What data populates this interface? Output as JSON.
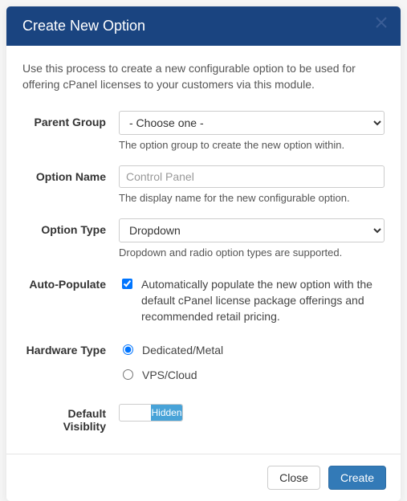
{
  "modal": {
    "title": "Create New Option",
    "intro": "Use this process to create a new configurable option to be used for offering cPanel licenses to your customers via this module."
  },
  "form": {
    "parent_group": {
      "label": "Parent Group",
      "selected": "- Choose one -",
      "help": "The option group to create the new option within."
    },
    "option_name": {
      "label": "Option Name",
      "placeholder": "Control Panel",
      "value": "",
      "help": "The display name for the new configurable option."
    },
    "option_type": {
      "label": "Option Type",
      "selected": "Dropdown",
      "help": "Dropdown and radio option types are supported."
    },
    "auto_populate": {
      "label": "Auto-Populate",
      "checked": true,
      "text": "Automatically populate the new option with the default cPanel license package offerings and recommended retail pricing."
    },
    "hardware_type": {
      "label": "Hardware Type",
      "options": [
        {
          "label": "Dedicated/Metal",
          "selected": true
        },
        {
          "label": "VPS/Cloud",
          "selected": false
        }
      ]
    },
    "default_visibility": {
      "label": "Default Visiblity",
      "state": "Hidden"
    }
  },
  "footer": {
    "close": "Close",
    "create": "Create"
  }
}
